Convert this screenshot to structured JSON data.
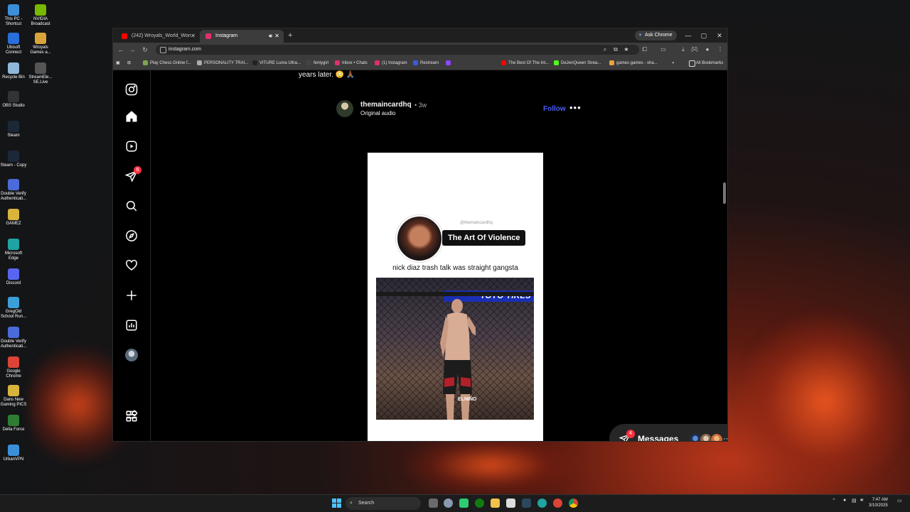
{
  "desktop": {
    "icons": [
      {
        "label": "This PC - Shortcut",
        "color": "#3b8fd9"
      },
      {
        "label": "NVIDIA Broadcast",
        "color": "#76b900"
      },
      {
        "label": "Ubisoft Connect",
        "color": "#2a6edb"
      },
      {
        "label": "Wroyals Games a...",
        "color": "#d9a53b"
      },
      {
        "label": "Recycle Bin",
        "color": "#8fb7d9"
      },
      {
        "label": "StreamEle... SE.Live",
        "color": "#555555"
      },
      {
        "label": "OBS Studio",
        "color": "#333333"
      },
      {
        "label": "Steam",
        "color": "#1b2838"
      },
      {
        "label": "Steam - Copy",
        "color": "#1b2838"
      },
      {
        "label": "Double Verify Authenticati...",
        "color": "#4a6bd9"
      },
      {
        "label": "GAMEZ",
        "color": "#d9b43b"
      },
      {
        "label": "Microsoft Edge",
        "color": "#1fa3a3"
      },
      {
        "label": "Discord",
        "color": "#5865f2"
      },
      {
        "label": "GregOld School Run...",
        "color": "#3b9fd9"
      },
      {
        "label": "Double Verify Authenticati...",
        "color": "#4a6bd9"
      },
      {
        "label": "Google Chrome",
        "color": "#db4437"
      },
      {
        "label": "Dans New Gaming PICS",
        "color": "#d9b43b"
      },
      {
        "label": "Delta Force",
        "color": "#2e7d32"
      },
      {
        "label": "UrbanVPN",
        "color": "#3b8fd9"
      }
    ]
  },
  "browser": {
    "tabs": [
      {
        "title": "(242) Wroyals_World_Won - Yo...",
        "icon_color": "#ff0000"
      },
      {
        "title": "Instagram",
        "icon_color": "#e1306c"
      }
    ],
    "new_tab": "+",
    "ask_chrome": "Ask Chrome",
    "url": "instagram.com",
    "bookmarks": [
      {
        "label": "Play Chess Online f...",
        "color": "#7fa650"
      },
      {
        "label": "PERSONALITY TRAI...",
        "color": "#aaaaaa"
      },
      {
        "label": "VITURE Luma Ultra...",
        "color": "#222222"
      },
      {
        "label": "fentygirl",
        "color": "#444444"
      },
      {
        "label": "Inbox • Chats",
        "color": "#e1306c"
      },
      {
        "label": "(1) Instagram",
        "color": "#e1306c"
      },
      {
        "label": "Restream",
        "color": "#3b5bdb"
      },
      {
        "label": "",
        "color": "#9146ff"
      },
      {
        "label": "The Best Of The Int...",
        "color": "#ff0000"
      },
      {
        "label": "DeJenQueen Strea...",
        "color": "#53fc18"
      },
      {
        "label": "games games - sha...",
        "color": "#e8a33b"
      }
    ],
    "all_bookmarks": "All Bookmarks"
  },
  "instagram": {
    "notification_badge": "6",
    "caption_tail": "years later. 😳 🙏🏾",
    "post": {
      "username": "themaincardhq",
      "time": "• 3w",
      "audio": "Original audio",
      "follow": "Follow",
      "more": "•••",
      "reel_handle": "@themaincardhq",
      "reel_title": "The Art Of Violence",
      "reel_caption": "nick diaz trash talk was straight gangsta",
      "banner_text": "TOYO TIRES",
      "shorts_text": "ELNIÑO",
      "mute_icon": "speaker-icon"
    },
    "messages": {
      "label": "Messages",
      "badge": "4",
      "more": "···"
    }
  },
  "taskbar": {
    "search_placeholder": "Search",
    "time": "7:47 AM",
    "date": "3/10/2025"
  }
}
